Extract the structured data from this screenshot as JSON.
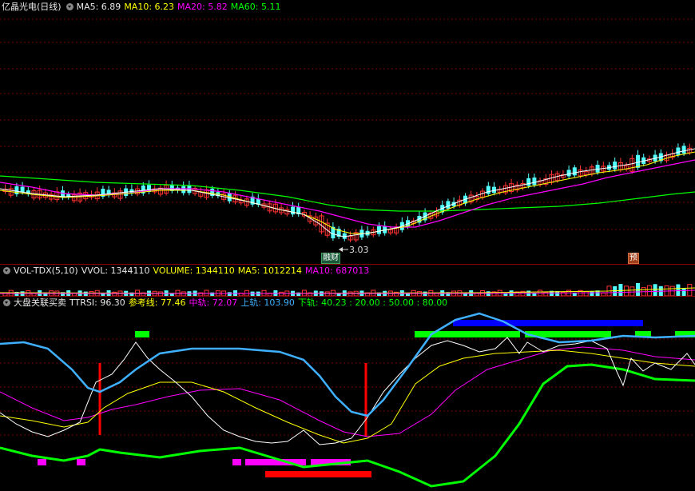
{
  "price_header": {
    "stock": "亿晶光电(日线)",
    "ma5": "MA5: 6.89",
    "ma10": "MA10: 6.23",
    "ma20": "MA20: 5.82",
    "ma60": "MA60: 5.11"
  },
  "price_chart": {
    "low_label": "3.03",
    "badge_left": "融财",
    "badge_right": "预"
  },
  "vol_header": {
    "name": "VOL-TDX(5,10)",
    "vvol": "VVOL: 1344110",
    "volume": "VOLUME: 1344110",
    "ma5": "MA5: 1012214",
    "ma10": "MA10: 687013"
  },
  "ind_header": {
    "name": "大盘关联买卖",
    "ttrsi": "TTRSI: 96.30",
    "ref": "参考线: 77.46",
    "mid": "中轨: 72.07",
    "up": "上轨: 103.90",
    "down": "下轨: 40.23 : 20.00 : 50.00 : 80.00"
  },
  "colors": {
    "ma5": "#ffffff",
    "ma10": "#ffff00",
    "ma20": "#ff00ff",
    "ma60": "#00ff00",
    "up_candle": "#ff3333",
    "down_candle": "#54ffff",
    "ttrsi": "#ffffff",
    "ref": "#ffff00",
    "mid": "#ff00ff",
    "upper": "#3fb0ff",
    "lower": "#00ff00"
  }
}
